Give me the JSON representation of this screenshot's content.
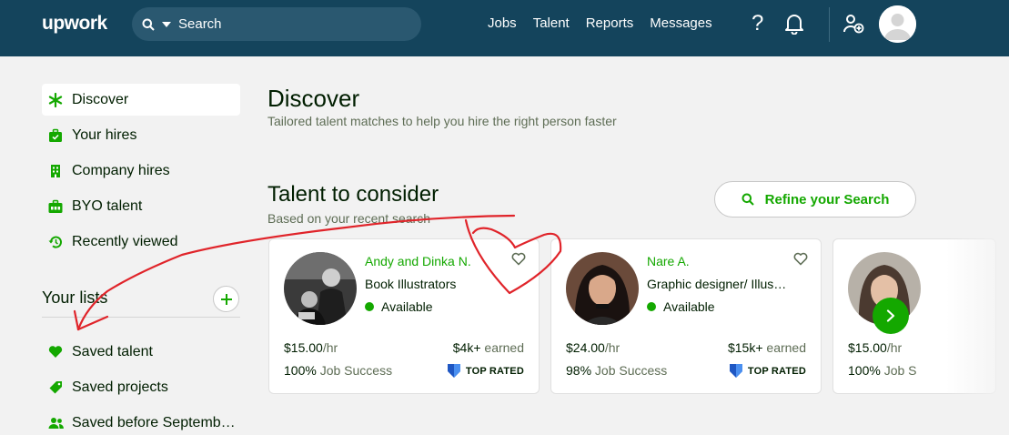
{
  "header": {
    "logo": "upwork",
    "search_placeholder": "Search",
    "nav": [
      "Jobs",
      "Talent",
      "Reports",
      "Messages"
    ],
    "help_glyph": "?"
  },
  "sidebar": {
    "items": [
      {
        "label": "Discover",
        "icon": "asterisk-icon"
      },
      {
        "label": "Your hires",
        "icon": "briefcase-check-icon"
      },
      {
        "label": "Company hires",
        "icon": "building-icon"
      },
      {
        "label": "BYO talent",
        "icon": "byo-briefcase-icon"
      },
      {
        "label": "Recently viewed",
        "icon": "history-icon"
      }
    ],
    "lists_title": "Your lists",
    "lists": [
      {
        "label": "Saved talent",
        "icon": "heart-icon"
      },
      {
        "label": "Saved projects",
        "icon": "tag-icon"
      },
      {
        "label": "Saved before Septemb…",
        "icon": "users-icon"
      }
    ]
  },
  "main": {
    "title": "Discover",
    "subtitle": "Tailored talent matches to help you hire the right person faster",
    "section_title": "Talent to consider",
    "section_subtitle": "Based on your recent search",
    "refine_label": "Refine your Search"
  },
  "cards": [
    {
      "name": "Andy and Dinka N.",
      "title": "Book Illustrators",
      "availability": "Available",
      "rate": "$15.00",
      "rate_unit": "/hr",
      "earned": "$4k+",
      "earned_suffix": " earned",
      "success": "100%",
      "success_suffix": " Job Success",
      "badge": "TOP RATED"
    },
    {
      "name": "Nare A.",
      "title": "Graphic designer/ Illus…",
      "availability": "Available",
      "rate": "$24.00",
      "rate_unit": "/hr",
      "earned": "$15k+",
      "earned_suffix": " earned",
      "success": "98%",
      "success_suffix": " Job Success",
      "badge": "TOP RATED"
    },
    {
      "rate": "$15.00",
      "rate_unit": "/hr",
      "success": "100%",
      "success_suffix": " Job S"
    }
  ],
  "colors": {
    "header_bg": "#14445c",
    "accent_green": "#14a800",
    "annotation_red": "#e0242a",
    "badge_blue": "#1f57c3"
  }
}
